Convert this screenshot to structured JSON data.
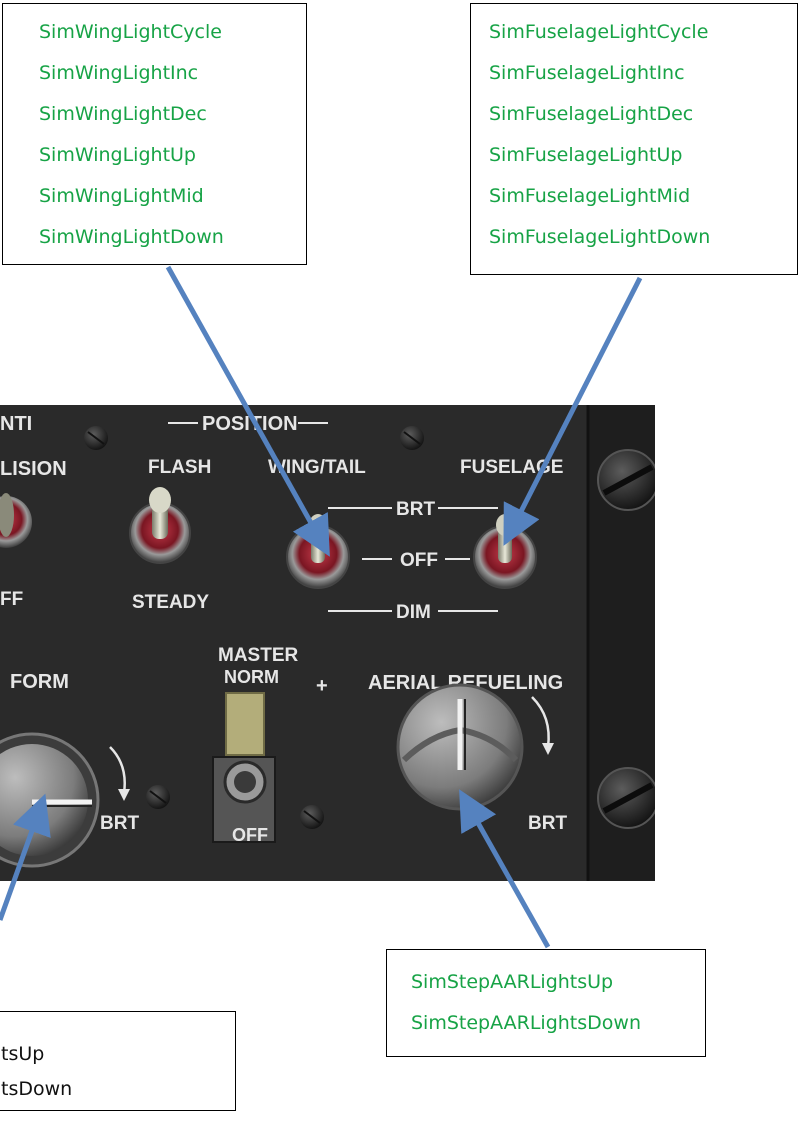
{
  "callouts": {
    "wing": [
      "SimWingLightCycle",
      "SimWingLightInc",
      "SimWingLightDec",
      "SimWingLightUp",
      "SimWingLightMid",
      "SimWingLightDown"
    ],
    "fuselage": [
      "SimFuselageLightCycle",
      "SimFuselageLightInc",
      "SimFuselageLightDec",
      "SimFuselageLightUp",
      "SimFuselageLightMid",
      "SimFuselageLightDown"
    ],
    "aar": [
      "SimStepAARLightsUp",
      "SimStepAARLightsDown"
    ],
    "formation_partial": [
      "tsUp",
      "tsDown"
    ]
  },
  "panel": {
    "anti_collision_top": "NTI",
    "anti_collision_bottom": "LISION",
    "anti_collision_off": "FF",
    "position": "POSITION",
    "flash": "FLASH",
    "steady": "STEADY",
    "wing_tail": "WING/TAIL",
    "fuselage": "FUSELAGE",
    "brt": "BRT",
    "off": "OFF",
    "dim": "DIM",
    "form": "FORM",
    "form_brt": "BRT",
    "master": "MASTER",
    "norm": "NORM",
    "master_off": "OFF",
    "plus": "+",
    "aerial_refueling": "AERIAL REFUELING",
    "aar_brt": "BRT"
  },
  "colors": {
    "command_text": "#17a346",
    "arrow": "#5582bf",
    "panel": "#262626",
    "label": "#e6e6e6"
  }
}
